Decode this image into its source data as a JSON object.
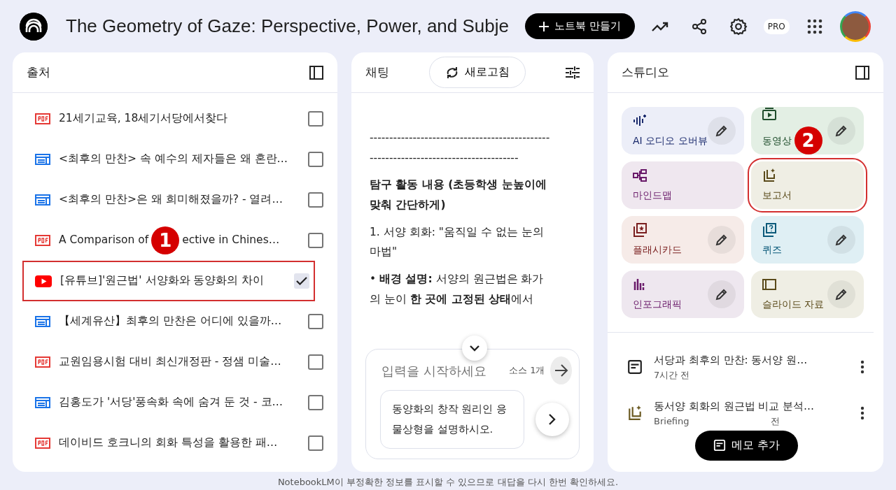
{
  "header": {
    "title": "The Geometry of Gaze: Perspective, Power, and Subje",
    "create_button": "노트북 만들기",
    "plan_badge": "PRO"
  },
  "sources": {
    "title": "출처",
    "items": [
      {
        "kind": "pdf",
        "title": "21세기교육, 18세기서당에서찾다",
        "checked": false,
        "highlighted": false
      },
      {
        "kind": "web",
        "title": "<최후의 만찬> 속 예수의 제자들은 왜 혼란…",
        "checked": false,
        "highlighted": false
      },
      {
        "kind": "web",
        "title": "<최후의 만찬>은 왜 희미해졌을까? - 열려…",
        "checked": false,
        "highlighted": false
      },
      {
        "kind": "pdf",
        "title": "A Comparison of",
        "title_after_callout": "ective in Chines…",
        "callout": "1",
        "checked": false,
        "highlighted": false
      },
      {
        "kind": "youtube",
        "title": "[유튜브]'원근법' 서양화와 동양화의 차이",
        "checked": true,
        "highlighted": true
      },
      {
        "kind": "web",
        "title": "【세계유산】최후의 만찬은 어디에 있을까…",
        "checked": false,
        "highlighted": false
      },
      {
        "kind": "pdf",
        "title": "교원임용시험 대비 최신개정판 - 정샘 미술…",
        "checked": false,
        "highlighted": false
      },
      {
        "kind": "web",
        "title": "김홍도가 '서당'풍속화 속에 숨겨 둔 것 - 코…",
        "checked": false,
        "highlighted": false
      },
      {
        "kind": "pdf",
        "title": "데이비드 호크니의 회화 특성을 활용한 패…",
        "checked": false,
        "highlighted": false
      }
    ]
  },
  "chat": {
    "title": "채팅",
    "refresh_button": "새로고침",
    "messages": [
      "------------------------------------------------------------------------------------",
      "**탐구 활동 내용 (초등학생 눈높이에 맞춰 간단하게)**",
      "1. 서양 회화: \"움직일 수 없는 눈의 마법\"",
      "• **배경 설명:** 서양의 원근법은 화가의 눈이 **한 곳에 고정된 상태**에서"
    ],
    "input": {
      "placeholder": "입력을 시작하세요",
      "source_count": "소스 1개"
    },
    "suggestion": "동양화의 창작 원리인 응물상형을 설명하시오."
  },
  "studio": {
    "title": "스튜디오",
    "tiles": [
      {
        "kind": "audio",
        "label": "AI 오디오 오버뷰",
        "color": "#eceef8",
        "editable": true,
        "highlighted": false
      },
      {
        "kind": "video",
        "label": "동영상",
        "callout": "2",
        "color": "#e3efe4",
        "editable": true,
        "highlighted": false
      },
      {
        "kind": "mindmap",
        "label": "마인드맵",
        "color": "#efe7ef",
        "editable": false,
        "highlighted": false
      },
      {
        "kind": "report",
        "label": "보고서",
        "color": "#efeee4",
        "editable": false,
        "highlighted": true
      },
      {
        "kind": "flashcard",
        "label": "플래시카드",
        "color": "#f6ebe8",
        "editable": true,
        "highlighted": false
      },
      {
        "kind": "quiz",
        "label": "퀴즈",
        "color": "#dfeff4",
        "editable": true,
        "highlighted": false
      },
      {
        "kind": "infographic",
        "label": "인포그래픽",
        "color": "#eee7ef",
        "editable": true,
        "highlighted": false
      },
      {
        "kind": "slides",
        "label": "슬라이드 자료",
        "color": "#efeee4",
        "editable": true,
        "highlighted": false
      }
    ],
    "notes": [
      {
        "kind": "note",
        "title": "서당과 최후의 만찬: 동서양 원…",
        "subtitle": "7시간 전"
      },
      {
        "kind": "report",
        "title": "동서양 회화의 원근법 비교 분석…",
        "subtitle": "Briefing",
        "subtitle_end": "전"
      }
    ],
    "add_note_button": "메모 추가"
  },
  "footer": "NotebookLM이 부정확한 정보를 표시할 수 있으므로 대답을 다시 한번 확인하세요."
}
